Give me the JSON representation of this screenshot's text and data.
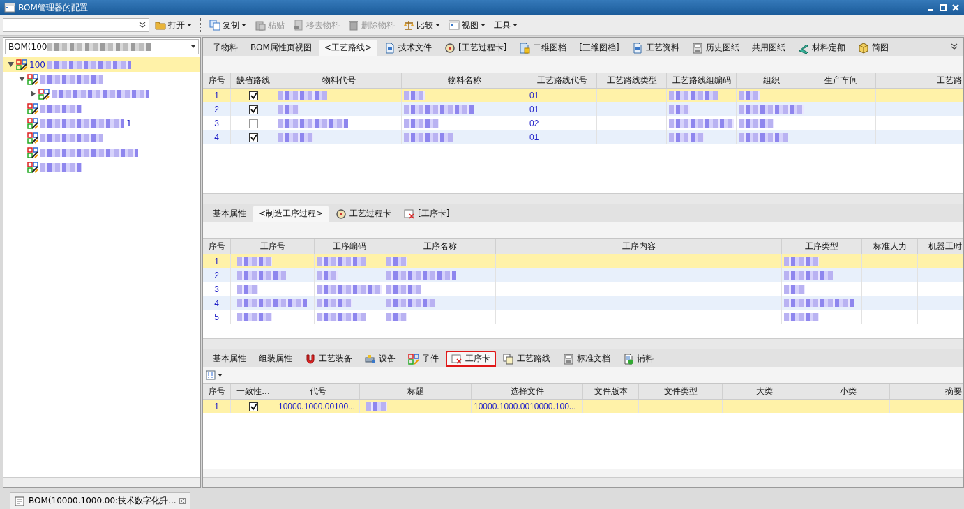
{
  "window": {
    "title": "BOM管理器的配置"
  },
  "toolbar": {
    "items": [
      {
        "label": "打开",
        "kind": "folder",
        "dropdown": true,
        "disabled": false
      },
      {
        "label": "复制",
        "kind": "copy",
        "dropdown": true,
        "disabled": false
      },
      {
        "label": "粘贴",
        "kind": "paste",
        "dropdown": false,
        "disabled": true
      },
      {
        "label": "移去物料",
        "kind": "remove",
        "dropdown": false,
        "disabled": true
      },
      {
        "label": "删除物料",
        "kind": "trash",
        "dropdown": false,
        "disabled": true
      },
      {
        "label": "比较",
        "kind": "scale",
        "dropdown": true,
        "disabled": false
      },
      {
        "label": "视图",
        "kind": "view",
        "dropdown": true,
        "disabled": false
      },
      {
        "label": "工具",
        "kind": "none",
        "dropdown": true,
        "disabled": false
      }
    ]
  },
  "sidebar": {
    "selector": {
      "value": "BOM(100",
      "obscured": true
    },
    "tree": [
      {
        "label": "100",
        "obscured": true,
        "selected": true,
        "expanded": true,
        "children": [
          {
            "obscured": true,
            "selected": false,
            "expanded": true,
            "children": [
              {
                "obscured": true,
                "selected": false,
                "expanded": false
              }
            ]
          },
          {
            "obscured": true,
            "selected": false
          },
          {
            "obscured": true,
            "selected": false,
            "label_tail": "1"
          },
          {
            "obscured": true,
            "selected": false
          },
          {
            "obscured": true,
            "selected": false
          },
          {
            "obscured": true,
            "selected": false
          }
        ]
      }
    ]
  },
  "top_tabs": [
    {
      "label": "子物料",
      "kind": "none",
      "selected": false
    },
    {
      "label": "BOM属性页视图",
      "kind": "none",
      "selected": false
    },
    {
      "label": "<工艺路线>",
      "kind": "none",
      "selected": true
    },
    {
      "label": "技术文件",
      "kind": "doc",
      "selected": false
    },
    {
      "label": "[工艺过程卡]",
      "kind": "card",
      "selected": false
    },
    {
      "label": "二维图档",
      "kind": "sheet",
      "selected": false
    },
    {
      "label": "[三维图档]",
      "kind": "none",
      "selected": false
    },
    {
      "label": "工艺资料",
      "kind": "doc",
      "selected": false
    },
    {
      "label": "历史图纸",
      "kind": "floppy",
      "selected": false
    },
    {
      "label": "共用图纸",
      "kind": "none",
      "selected": false
    },
    {
      "label": "材料定额",
      "kind": "ruler",
      "selected": false
    },
    {
      "label": "简图",
      "kind": "box",
      "selected": false
    }
  ],
  "route_table": {
    "columns": [
      "序号",
      "缺省路线",
      "物料代号",
      "物料名称",
      "工艺路线代号",
      "工艺路线类型",
      "工艺路线组编码",
      "组织",
      "生产车间",
      "工艺路"
    ],
    "rows": [
      {
        "selected": true,
        "cells": [
          "1",
          {
            "kind": "check",
            "checked": true
          },
          {
            "kind": "blur"
          },
          {
            "kind": "blur"
          },
          "01",
          null,
          {
            "kind": "blur"
          },
          {
            "kind": "blur"
          },
          null,
          null
        ]
      },
      {
        "selected": false,
        "cells": [
          "2",
          {
            "kind": "check",
            "checked": true
          },
          {
            "kind": "blur"
          },
          {
            "kind": "blur"
          },
          "01",
          null,
          {
            "kind": "blur"
          },
          {
            "kind": "blur"
          },
          null,
          null
        ]
      },
      {
        "selected": false,
        "cells": [
          "3",
          {
            "kind": "check",
            "checked": false
          },
          {
            "kind": "blur"
          },
          {
            "kind": "blur"
          },
          "02",
          null,
          {
            "kind": "blur"
          },
          {
            "kind": "blur"
          },
          null,
          null
        ]
      },
      {
        "selected": false,
        "cells": [
          "4",
          {
            "kind": "check",
            "checked": true
          },
          {
            "kind": "blur"
          },
          {
            "kind": "blur"
          },
          "01",
          null,
          {
            "kind": "blur"
          },
          {
            "kind": "blur"
          },
          null,
          null
        ]
      }
    ]
  },
  "process_tabs": [
    {
      "label": "基本属性",
      "kind": "none",
      "selected": false
    },
    {
      "label": "<制造工序过程>",
      "kind": "none",
      "selected": true
    },
    {
      "label": "工艺过程卡",
      "kind": "card",
      "selected": false
    },
    {
      "label": "[工序卡]",
      "kind": "card2",
      "selected": false
    }
  ],
  "process_table": {
    "columns": [
      "序号",
      "工序号",
      "工序编码",
      "工序名称",
      "工序内容",
      "工序类型",
      "标准人力",
      "机器工时"
    ],
    "rows": [
      {
        "selected": true,
        "cells": [
          "1",
          {
            "kind": "blur"
          },
          {
            "kind": "blur"
          },
          {
            "kind": "blur"
          },
          null,
          {
            "kind": "blur"
          },
          null,
          null
        ]
      },
      {
        "selected": false,
        "cells": [
          "2",
          {
            "kind": "blur"
          },
          {
            "kind": "blur"
          },
          {
            "kind": "blur"
          },
          null,
          {
            "kind": "blur"
          },
          null,
          null
        ]
      },
      {
        "selected": false,
        "cells": [
          "3",
          {
            "kind": "blur"
          },
          {
            "kind": "blur"
          },
          {
            "kind": "blur"
          },
          null,
          {
            "kind": "blur"
          },
          null,
          null
        ]
      },
      {
        "selected": false,
        "cells": [
          "4",
          {
            "kind": "blur"
          },
          {
            "kind": "blur"
          },
          {
            "kind": "blur"
          },
          null,
          {
            "kind": "blur"
          },
          null,
          null
        ]
      },
      {
        "selected": false,
        "cells": [
          "5",
          {
            "kind": "blur"
          },
          {
            "kind": "blur"
          },
          {
            "kind": "blur"
          },
          null,
          {
            "kind": "blur"
          },
          null,
          null
        ]
      }
    ]
  },
  "detail_tabs": [
    {
      "label": "基本属性",
      "kind": "none",
      "selected": false,
      "highlighted": false
    },
    {
      "label": "组装属性",
      "kind": "none",
      "selected": false,
      "highlighted": false
    },
    {
      "label": "工艺装备",
      "kind": "magnet",
      "selected": false,
      "highlighted": false
    },
    {
      "label": "设备",
      "kind": "device",
      "selected": false,
      "highlighted": false
    },
    {
      "label": "子件",
      "kind": "parts",
      "selected": false,
      "highlighted": false
    },
    {
      "label": "工序卡",
      "kind": "card2",
      "selected": true,
      "highlighted": true
    },
    {
      "label": "工艺路线",
      "kind": "route",
      "selected": false,
      "highlighted": false
    },
    {
      "label": "标准文档",
      "kind": "floppy",
      "selected": false,
      "highlighted": false
    },
    {
      "label": "辅料",
      "kind": "material",
      "selected": false,
      "highlighted": false
    }
  ],
  "doc_table": {
    "columns": [
      "序号",
      "一致性...",
      "代号",
      "标题",
      "选择文件",
      "文件版本",
      "文件类型",
      "大类",
      "小类",
      "摘要"
    ],
    "rows": [
      {
        "selected": true,
        "cells": [
          "1",
          {
            "kind": "check",
            "checked": true
          },
          "10000.1000.00100...",
          {
            "kind": "blur"
          },
          "10000.1000.0010000.100...",
          null,
          null,
          null,
          null,
          null
        ]
      }
    ]
  },
  "taskbar": {
    "tabs": [
      {
        "label": "BOM(10000.1000.00:技术数字化升..."
      }
    ]
  }
}
